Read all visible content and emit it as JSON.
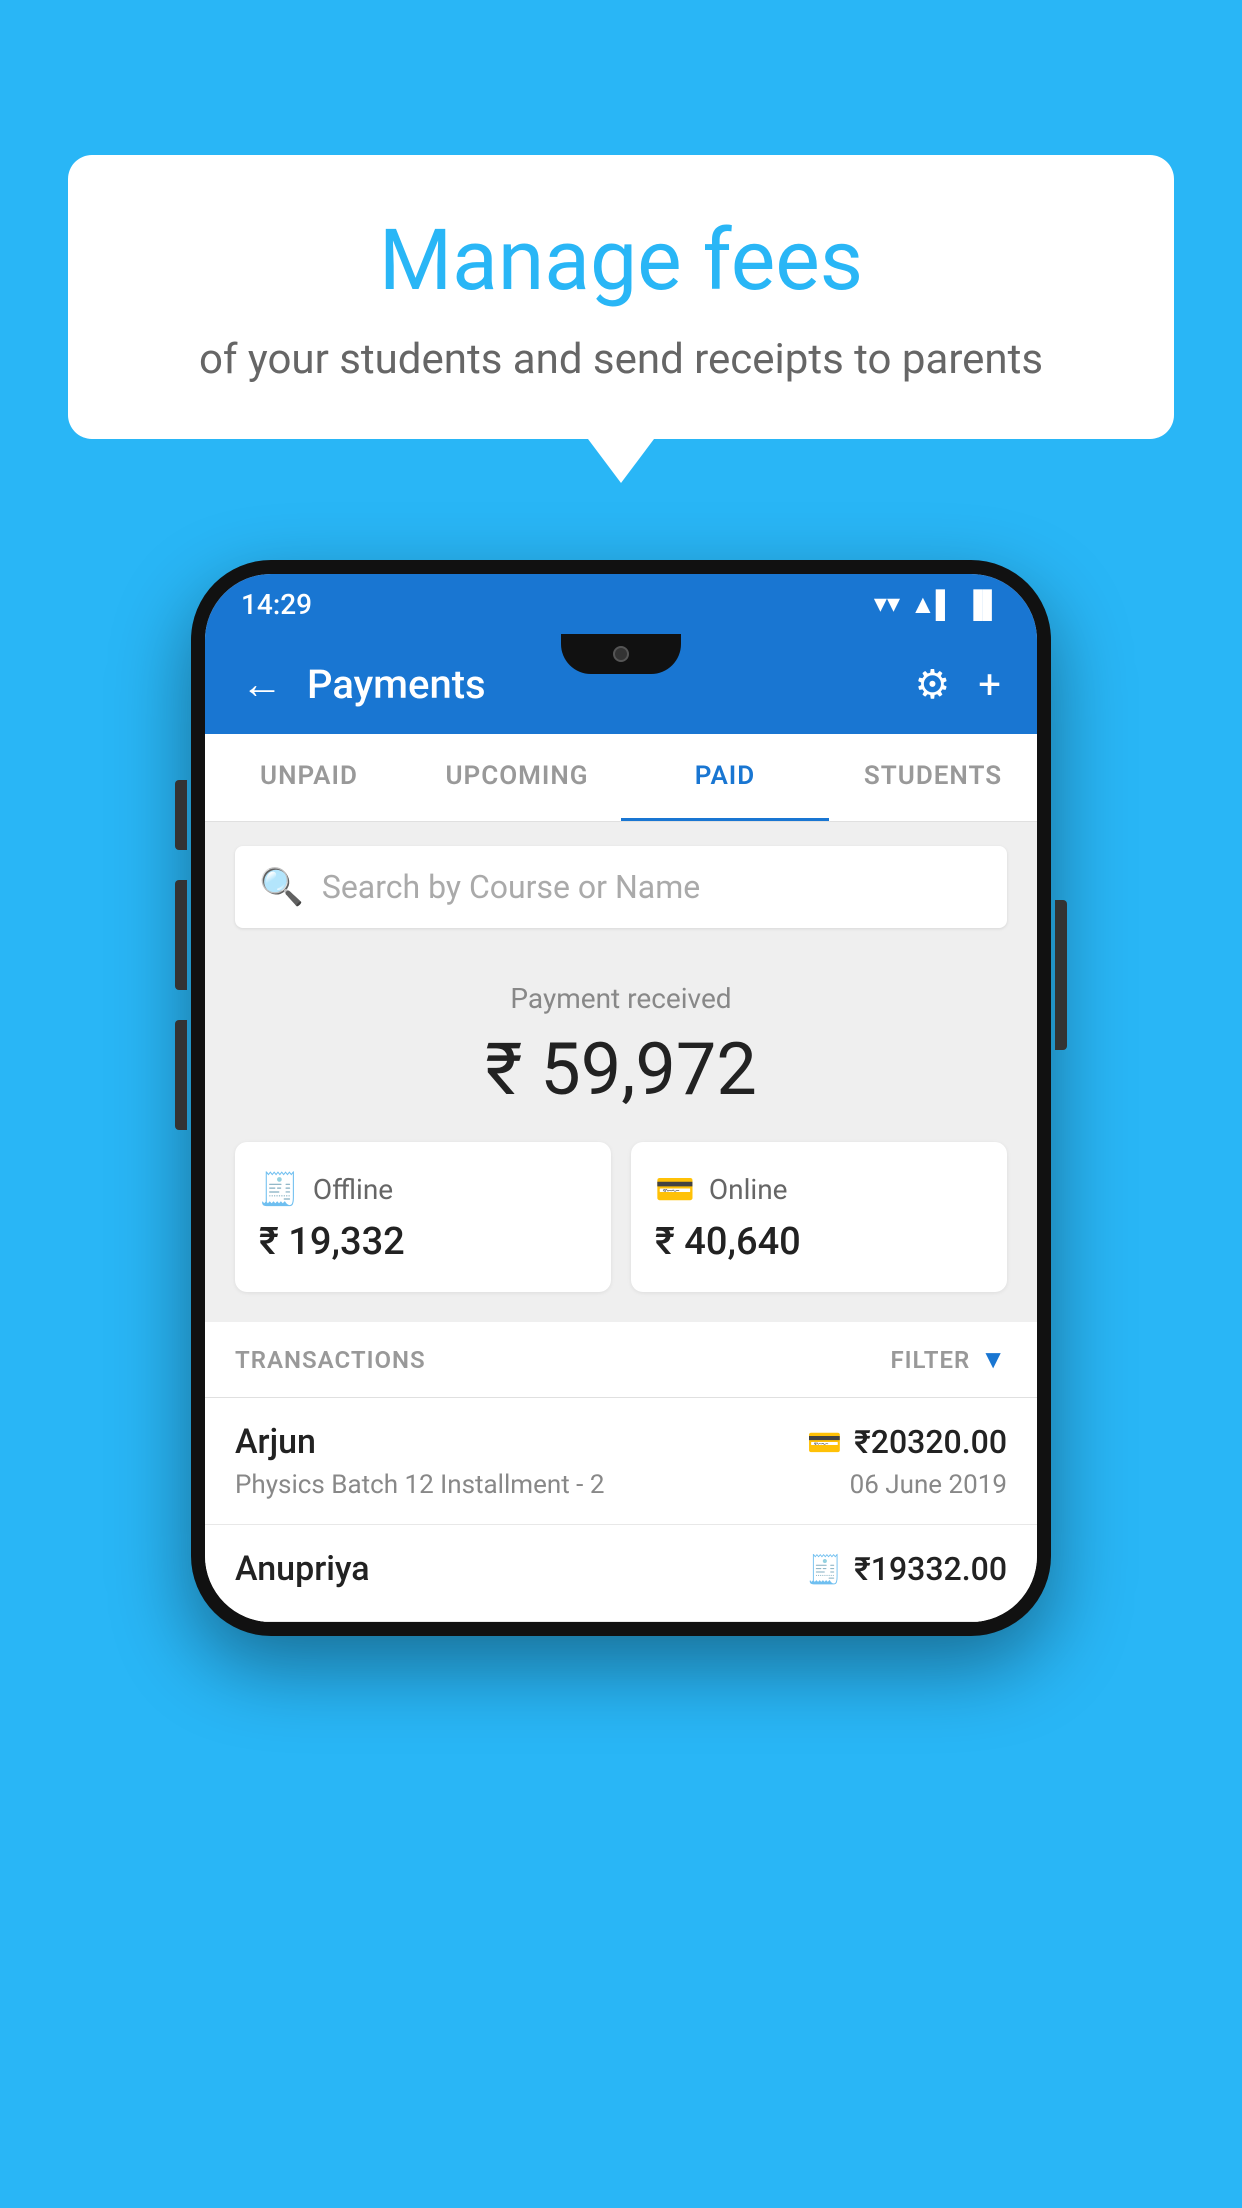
{
  "background_color": "#29B6F6",
  "speech_bubble": {
    "main_title": "Manage fees",
    "sub_title": "of your students and send receipts to parents"
  },
  "status_bar": {
    "time": "14:29",
    "wifi": "▼",
    "signal": "▲",
    "battery": "▌"
  },
  "app_bar": {
    "title": "Payments",
    "back_label": "←",
    "gear_label": "⚙",
    "plus_label": "+"
  },
  "tabs": [
    {
      "label": "UNPAID",
      "active": false
    },
    {
      "label": "UPCOMING",
      "active": false
    },
    {
      "label": "PAID",
      "active": true
    },
    {
      "label": "STUDENTS",
      "active": false
    }
  ],
  "search": {
    "placeholder": "Search by Course or Name"
  },
  "payment_summary": {
    "label": "Payment received",
    "amount": "₹ 59,972"
  },
  "payment_cards": [
    {
      "label": "Offline",
      "amount": "₹ 19,332",
      "icon": "💳"
    },
    {
      "label": "Online",
      "amount": "₹ 40,640",
      "icon": "💳"
    }
  ],
  "transactions_section": {
    "label": "TRANSACTIONS",
    "filter_label": "FILTER"
  },
  "transactions": [
    {
      "name": "Arjun",
      "amount": "₹20320.00",
      "course": "Physics Batch 12 Installment - 2",
      "date": "06 June 2019",
      "type_icon": "💳"
    },
    {
      "name": "Anupriya",
      "amount": "₹19332.00",
      "course": "",
      "date": "",
      "type_icon": "🧾"
    }
  ]
}
